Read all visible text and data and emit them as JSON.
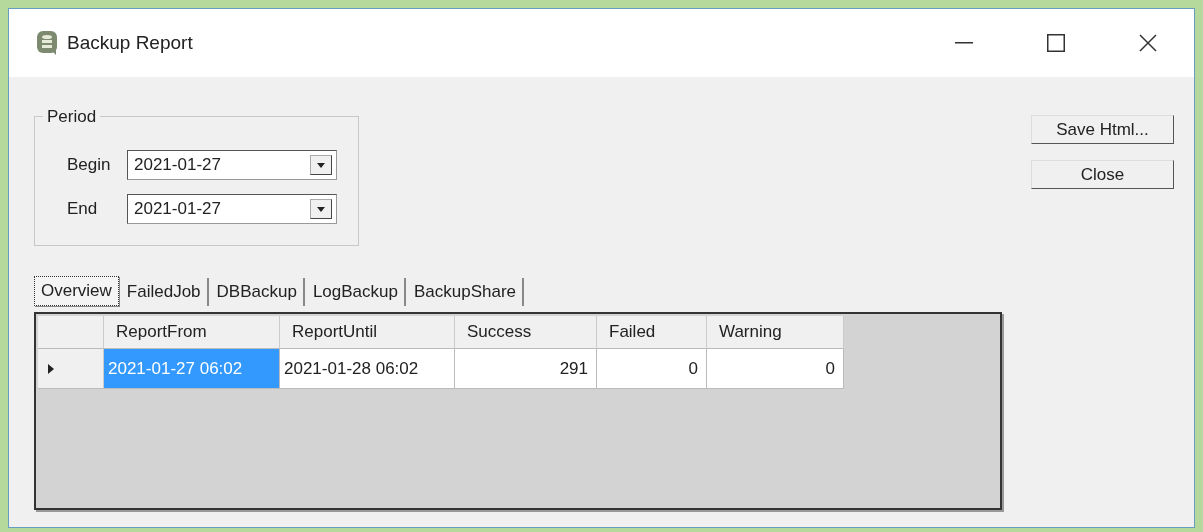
{
  "window": {
    "title": "Backup Report"
  },
  "period": {
    "label": "Period",
    "fields": [
      {
        "label": "Begin",
        "value": "2021-01-27"
      },
      {
        "label": "End",
        "value": "2021-01-27"
      }
    ]
  },
  "buttons": [
    "Save Html...",
    "Close"
  ],
  "tabs": [
    {
      "label": "Overview",
      "selected": true
    },
    {
      "label": "FailedJob",
      "selected": false
    },
    {
      "label": "DBBackup",
      "selected": false
    },
    {
      "label": "LogBackup",
      "selected": false
    },
    {
      "label": "BackupShare",
      "selected": false
    }
  ],
  "table": {
    "columns": [
      {
        "label": "ReportFrom",
        "kind": "text"
      },
      {
        "label": "ReportUntil",
        "kind": "text"
      },
      {
        "label": "Success",
        "kind": "number"
      },
      {
        "label": "Failed",
        "kind": "number"
      },
      {
        "label": "Warning",
        "kind": "number"
      }
    ],
    "rows": [
      {
        "current": true,
        "cells": [
          {
            "text": "2021-01-27 06:02",
            "selected": true
          },
          {
            "text": "2021-01-28 06:02",
            "selected": false
          },
          {
            "text": "291",
            "selected": false
          },
          {
            "text": "0",
            "selected": false
          },
          {
            "text": "0",
            "selected": false
          }
        ]
      }
    ]
  }
}
